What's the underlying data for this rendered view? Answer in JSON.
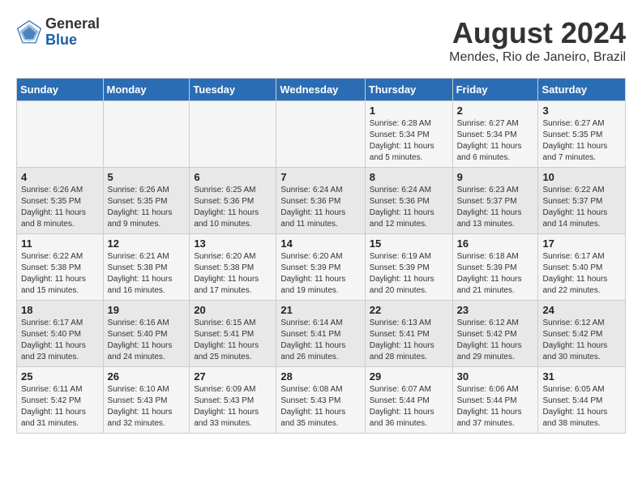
{
  "header": {
    "logo_general": "General",
    "logo_blue": "Blue",
    "month": "August 2024",
    "location": "Mendes, Rio de Janeiro, Brazil"
  },
  "days_of_week": [
    "Sunday",
    "Monday",
    "Tuesday",
    "Wednesday",
    "Thursday",
    "Friday",
    "Saturday"
  ],
  "weeks": [
    [
      {
        "day": "",
        "info": ""
      },
      {
        "day": "",
        "info": ""
      },
      {
        "day": "",
        "info": ""
      },
      {
        "day": "",
        "info": ""
      },
      {
        "day": "1",
        "info": "Sunrise: 6:28 AM\nSunset: 5:34 PM\nDaylight: 11 hours and 5 minutes."
      },
      {
        "day": "2",
        "info": "Sunrise: 6:27 AM\nSunset: 5:34 PM\nDaylight: 11 hours and 6 minutes."
      },
      {
        "day": "3",
        "info": "Sunrise: 6:27 AM\nSunset: 5:35 PM\nDaylight: 11 hours and 7 minutes."
      }
    ],
    [
      {
        "day": "4",
        "info": "Sunrise: 6:26 AM\nSunset: 5:35 PM\nDaylight: 11 hours and 8 minutes."
      },
      {
        "day": "5",
        "info": "Sunrise: 6:26 AM\nSunset: 5:35 PM\nDaylight: 11 hours and 9 minutes."
      },
      {
        "day": "6",
        "info": "Sunrise: 6:25 AM\nSunset: 5:36 PM\nDaylight: 11 hours and 10 minutes."
      },
      {
        "day": "7",
        "info": "Sunrise: 6:24 AM\nSunset: 5:36 PM\nDaylight: 11 hours and 11 minutes."
      },
      {
        "day": "8",
        "info": "Sunrise: 6:24 AM\nSunset: 5:36 PM\nDaylight: 11 hours and 12 minutes."
      },
      {
        "day": "9",
        "info": "Sunrise: 6:23 AM\nSunset: 5:37 PM\nDaylight: 11 hours and 13 minutes."
      },
      {
        "day": "10",
        "info": "Sunrise: 6:22 AM\nSunset: 5:37 PM\nDaylight: 11 hours and 14 minutes."
      }
    ],
    [
      {
        "day": "11",
        "info": "Sunrise: 6:22 AM\nSunset: 5:38 PM\nDaylight: 11 hours and 15 minutes."
      },
      {
        "day": "12",
        "info": "Sunrise: 6:21 AM\nSunset: 5:38 PM\nDaylight: 11 hours and 16 minutes."
      },
      {
        "day": "13",
        "info": "Sunrise: 6:20 AM\nSunset: 5:38 PM\nDaylight: 11 hours and 17 minutes."
      },
      {
        "day": "14",
        "info": "Sunrise: 6:20 AM\nSunset: 5:39 PM\nDaylight: 11 hours and 19 minutes."
      },
      {
        "day": "15",
        "info": "Sunrise: 6:19 AM\nSunset: 5:39 PM\nDaylight: 11 hours and 20 minutes."
      },
      {
        "day": "16",
        "info": "Sunrise: 6:18 AM\nSunset: 5:39 PM\nDaylight: 11 hours and 21 minutes."
      },
      {
        "day": "17",
        "info": "Sunrise: 6:17 AM\nSunset: 5:40 PM\nDaylight: 11 hours and 22 minutes."
      }
    ],
    [
      {
        "day": "18",
        "info": "Sunrise: 6:17 AM\nSunset: 5:40 PM\nDaylight: 11 hours and 23 minutes."
      },
      {
        "day": "19",
        "info": "Sunrise: 6:16 AM\nSunset: 5:40 PM\nDaylight: 11 hours and 24 minutes."
      },
      {
        "day": "20",
        "info": "Sunrise: 6:15 AM\nSunset: 5:41 PM\nDaylight: 11 hours and 25 minutes."
      },
      {
        "day": "21",
        "info": "Sunrise: 6:14 AM\nSunset: 5:41 PM\nDaylight: 11 hours and 26 minutes."
      },
      {
        "day": "22",
        "info": "Sunrise: 6:13 AM\nSunset: 5:41 PM\nDaylight: 11 hours and 28 minutes."
      },
      {
        "day": "23",
        "info": "Sunrise: 6:12 AM\nSunset: 5:42 PM\nDaylight: 11 hours and 29 minutes."
      },
      {
        "day": "24",
        "info": "Sunrise: 6:12 AM\nSunset: 5:42 PM\nDaylight: 11 hours and 30 minutes."
      }
    ],
    [
      {
        "day": "25",
        "info": "Sunrise: 6:11 AM\nSunset: 5:42 PM\nDaylight: 11 hours and 31 minutes."
      },
      {
        "day": "26",
        "info": "Sunrise: 6:10 AM\nSunset: 5:43 PM\nDaylight: 11 hours and 32 minutes."
      },
      {
        "day": "27",
        "info": "Sunrise: 6:09 AM\nSunset: 5:43 PM\nDaylight: 11 hours and 33 minutes."
      },
      {
        "day": "28",
        "info": "Sunrise: 6:08 AM\nSunset: 5:43 PM\nDaylight: 11 hours and 35 minutes."
      },
      {
        "day": "29",
        "info": "Sunrise: 6:07 AM\nSunset: 5:44 PM\nDaylight: 11 hours and 36 minutes."
      },
      {
        "day": "30",
        "info": "Sunrise: 6:06 AM\nSunset: 5:44 PM\nDaylight: 11 hours and 37 minutes."
      },
      {
        "day": "31",
        "info": "Sunrise: 6:05 AM\nSunset: 5:44 PM\nDaylight: 11 hours and 38 minutes."
      }
    ]
  ]
}
